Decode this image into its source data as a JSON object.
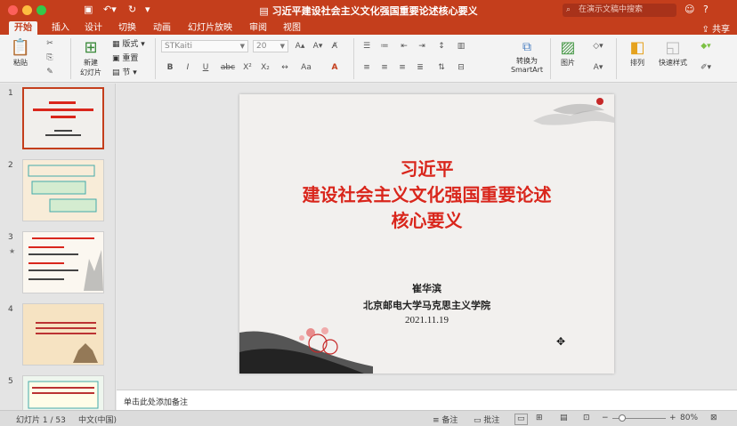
{
  "window": {
    "title": "习近平建设社会主义文化强国重要论述核心要义",
    "search_placeholder": "在演示文稿中搜索",
    "share_label": "共享"
  },
  "tabs": [
    {
      "label": "开始",
      "active": true
    },
    {
      "label": "插入"
    },
    {
      "label": "设计"
    },
    {
      "label": "切换"
    },
    {
      "label": "动画"
    },
    {
      "label": "幻灯片放映"
    },
    {
      "label": "审阅"
    },
    {
      "label": "视图"
    }
  ],
  "ribbon": {
    "paste_label": "粘贴",
    "new_slide_label_line1": "新建",
    "new_slide_label_line2": "幻灯片",
    "layout_label": "版式",
    "reset_label": "重置",
    "section_label": "节",
    "font_name": "STKaiti",
    "font_size": "20",
    "convert_smartart_line1": "转换为",
    "convert_smartart_line2": "SmartArt",
    "picture_label": "图片",
    "arrange_label": "排列",
    "quick_styles_label": "快速样式"
  },
  "thumbnails": [
    {
      "num": "1",
      "selected": true
    },
    {
      "num": "2"
    },
    {
      "num": "3",
      "starred": true
    },
    {
      "num": "4"
    },
    {
      "num": "5"
    }
  ],
  "slide": {
    "title_line1": "习近平",
    "title_line2": "建设社会主义文化强国重要论述",
    "title_line3": "核心要义",
    "author": "崔华滨",
    "institution": "北京邮电大学马克思主义学院",
    "date": "2021.11.19"
  },
  "notes_placeholder": "单击此处添加备注",
  "status": {
    "slide_indicator": "幻灯片 1 / 53",
    "language": "中文(中国)",
    "notes_label": "备注",
    "comments_label": "批注",
    "zoom": "80%"
  },
  "colors": {
    "accent": "#c43e1c",
    "title_red": "#d9261c"
  }
}
